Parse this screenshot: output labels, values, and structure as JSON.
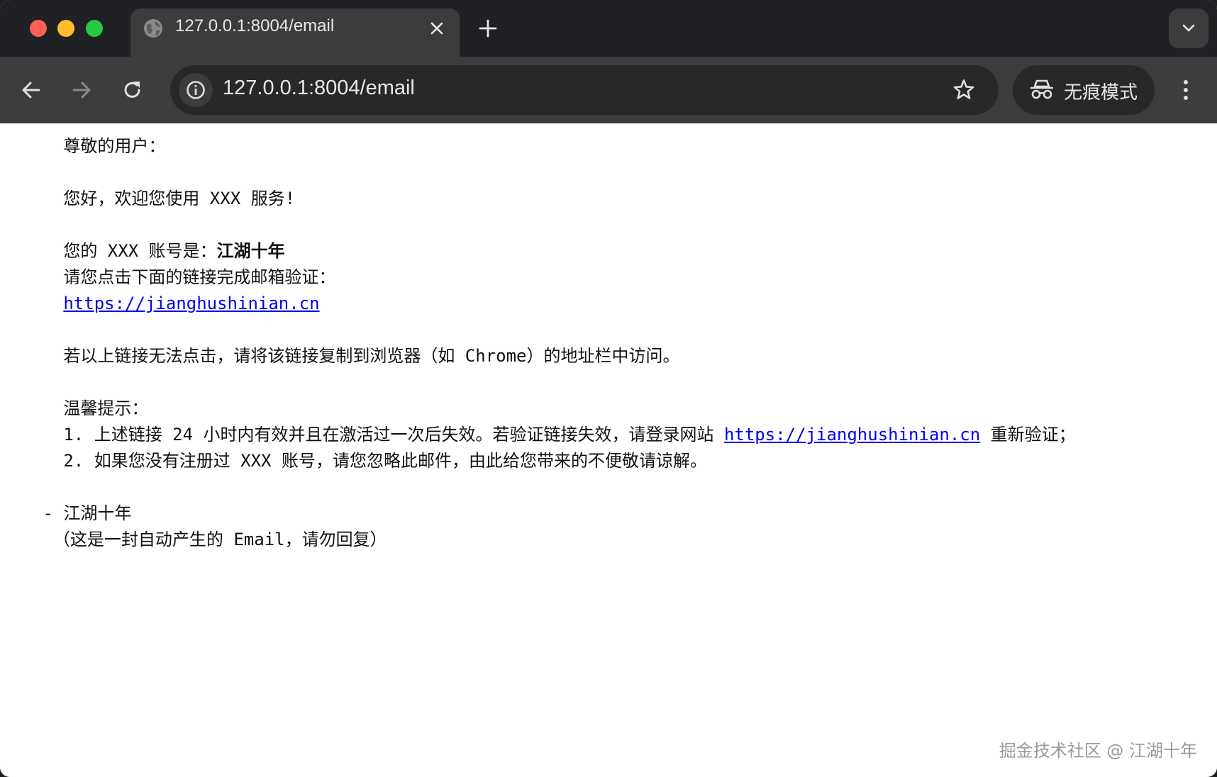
{
  "browser": {
    "tab_title": "127.0.0.1:8004/email",
    "url": "127.0.0.1:8004/email",
    "incognito_label": "无痕模式",
    "icons": [
      "globe-icon",
      "close-icon",
      "plus-icon",
      "chevron-down-icon",
      "back-arrow-icon",
      "forward-arrow-icon",
      "reload-icon",
      "info-icon",
      "star-icon",
      "incognito-icon",
      "more-vert-icon"
    ]
  },
  "email": {
    "greeting": "尊敬的用户：",
    "welcome": "您好，欢迎您使用 XXX 服务!",
    "account_prefix": "您的 XXX 账号是：",
    "account_name": "江湖十年",
    "verify_prompt": "请您点击下面的链接完成邮箱验证：",
    "verify_link": "https://jianghushinian.cn",
    "fallback_note": "若以上链接无法点击，请将该链接复制到浏览器（如 Chrome）的地址栏中访问。",
    "tips_title": "温馨提示：",
    "tip1_prefix": "1. 上述链接 24 小时内有效并且在激活过一次后失效。若验证链接失效，请登录网站 ",
    "tip1_link": "https://jianghushinian.cn",
    "tip1_suffix": " 重新验证；",
    "tip2": "2. 如果您没有注册过 XXX 账号，请您忽略此邮件，由此给您带来的不便敬请谅解。",
    "signature": "- 江湖十年",
    "auto_note": "（这是一封自动产生的 Email，请勿回复）"
  },
  "watermark": "掘金技术社区 @ 江湖十年"
}
